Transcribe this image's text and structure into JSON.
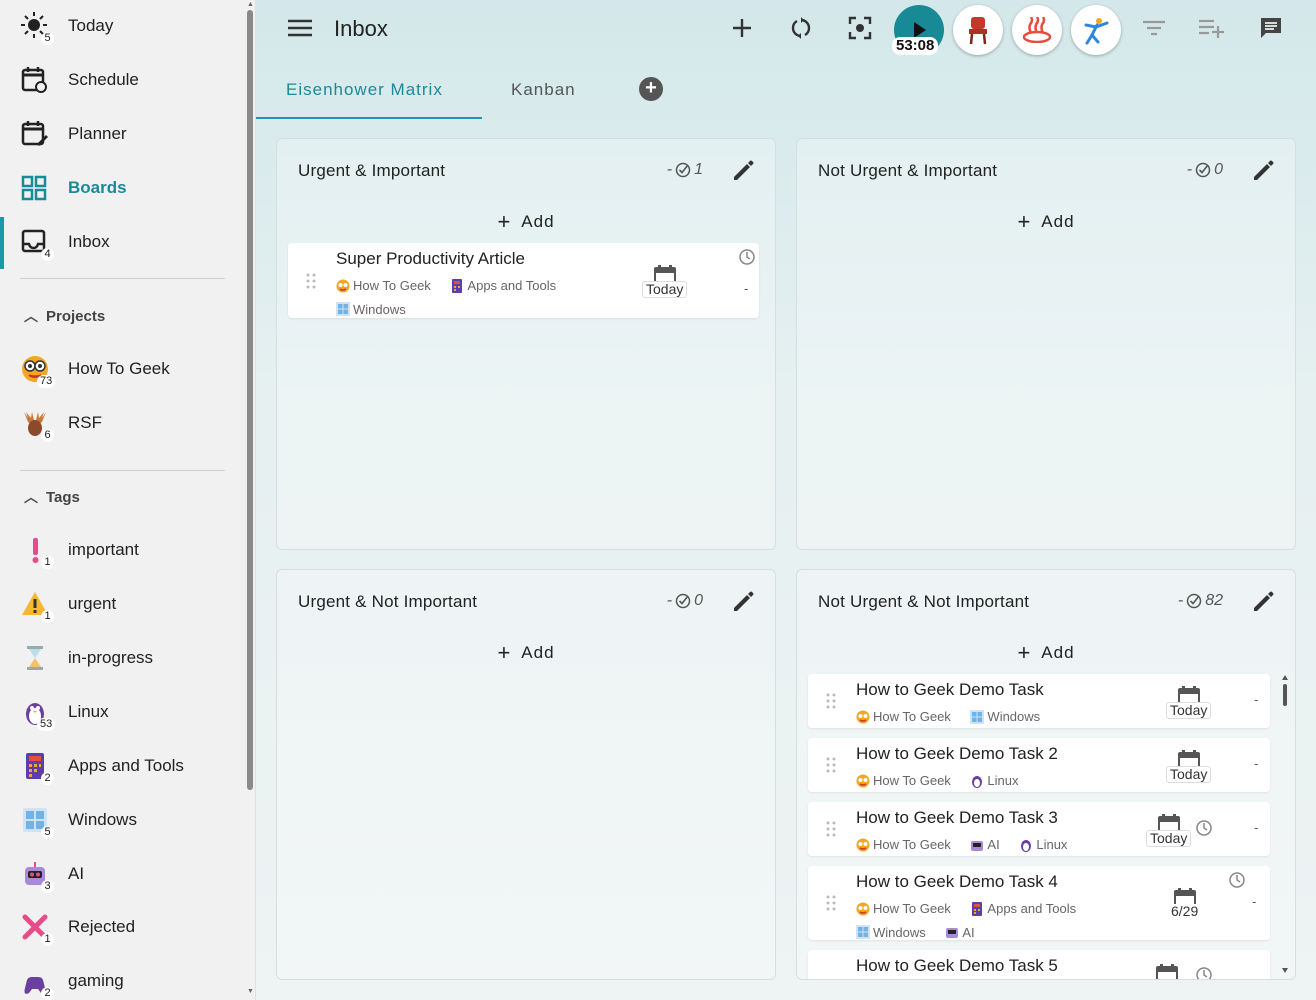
{
  "sidebar": {
    "nav": [
      {
        "label": "Today",
        "badge": "5",
        "icon": "sun-icon"
      },
      {
        "label": "Schedule",
        "icon": "calendar-clock-icon"
      },
      {
        "label": "Planner",
        "icon": "calendar-edit-icon"
      },
      {
        "label": "Boards",
        "icon": "grid-icon"
      },
      {
        "label": "Inbox",
        "badge": "4",
        "icon": "inbox-icon"
      }
    ],
    "projects_header": "Projects",
    "projects": [
      {
        "label": "How To Geek",
        "badge": "73"
      },
      {
        "label": "RSF",
        "badge": "6"
      }
    ],
    "tags_header": "Tags",
    "tags": [
      {
        "label": "important",
        "badge": "1"
      },
      {
        "label": "urgent",
        "badge": "1"
      },
      {
        "label": "in-progress"
      },
      {
        "label": "Linux",
        "badge": "53"
      },
      {
        "label": "Apps and Tools",
        "badge": "2"
      },
      {
        "label": "Windows",
        "badge": "5"
      },
      {
        "label": "AI",
        "badge": "3"
      },
      {
        "label": "Rejected",
        "badge": "1"
      },
      {
        "label": "gaming",
        "badge": "2"
      }
    ]
  },
  "header": {
    "title": "Inbox",
    "timer": "53:08"
  },
  "tabs": [
    "Eisenhower Matrix",
    "Kanban"
  ],
  "quadrants": {
    "q1": {
      "title": "Urgent & Important",
      "count": "- ",
      "count_num": "1",
      "add": "Add"
    },
    "q2": {
      "title": "Not Urgent & Important",
      "count": "- ",
      "count_num": "0",
      "add": "Add"
    },
    "q3": {
      "title": "Urgent & Not Important",
      "count": "- ",
      "count_num": "0",
      "add": "Add"
    },
    "q4": {
      "title": "Not Urgent & Not Important",
      "count": "- ",
      "count_num": "82",
      "add": "Add"
    }
  },
  "tasks": {
    "t0": {
      "title": "Super Productivity Article",
      "tag1": "How To Geek",
      "tag2": "Apps and Tools",
      "tag3": "Windows",
      "due": "Today",
      "dash": "-"
    },
    "t1": {
      "title": "How to Geek Demo Task",
      "tag1": "How To Geek",
      "tag2": "Windows",
      "due": "Today",
      "dash": "-"
    },
    "t2": {
      "title": "How to Geek Demo Task 2",
      "tag1": "How To Geek",
      "tag2": "Linux",
      "due": "Today",
      "dash": "-"
    },
    "t3": {
      "title": "How to Geek Demo Task 3",
      "tag1": "How To Geek",
      "tag2": "AI",
      "tag3": "Linux",
      "due": "Today",
      "dash": "-"
    },
    "t4": {
      "title": "How to Geek Demo Task 4",
      "tag1": "How To Geek",
      "tag2": "Apps and Tools",
      "tag3": "Windows",
      "tag4": "AI",
      "due": "6/29",
      "dash": "-"
    },
    "t5": {
      "title": "How to Geek Demo Task 5"
    }
  },
  "colors": {
    "accent": "#1a9aa8",
    "play": "#178a96"
  }
}
